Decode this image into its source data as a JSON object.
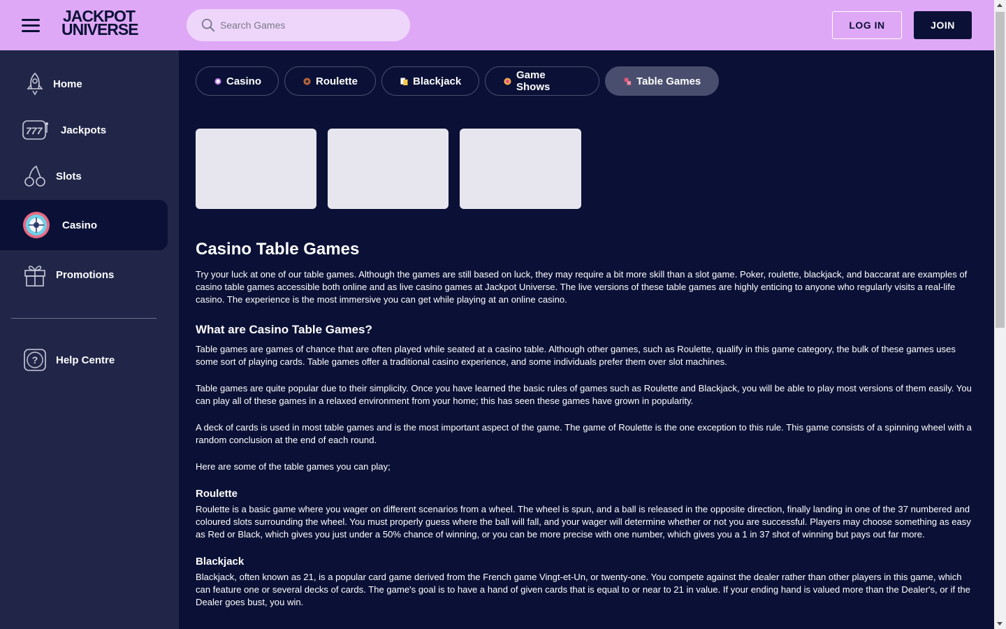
{
  "header": {
    "brand_line1": "JACKPOT",
    "brand_line2": "UNIVERSE",
    "search_placeholder": "Search Games",
    "login_label": "LOG IN",
    "join_label": "JOIN"
  },
  "sidebar": {
    "items": [
      {
        "label": "Home",
        "icon": "rocket-icon"
      },
      {
        "label": "Jackpots",
        "icon": "slot-machine-777-icon"
      },
      {
        "label": "Slots",
        "icon": "cherries-icon"
      },
      {
        "label": "Casino",
        "icon": "roulette-wheel-icon",
        "active": true
      },
      {
        "label": "Promotions",
        "icon": "gift-icon"
      }
    ],
    "help": {
      "label": "Help Centre",
      "icon": "help-question-icon"
    }
  },
  "tabs": [
    {
      "label": "Casino",
      "icon": "casino-chip-icon"
    },
    {
      "label": "Roulette",
      "icon": "roulette-icon"
    },
    {
      "label": "Blackjack",
      "icon": "cards-icon"
    },
    {
      "label": "Game Shows",
      "icon": "game-show-icon"
    },
    {
      "label": "Table Games",
      "icon": "dice-icon",
      "active": true
    }
  ],
  "colors": {
    "header_bg": "#dfa8f6",
    "main_bg": "#0b1136",
    "sidebar_bg": "#212649",
    "active_tab_bg": "#4a4e6e",
    "card_placeholder": "#e7e6ee"
  },
  "content": {
    "title": "Casino Table Games",
    "intro": "Try your luck at one of our table games. Although the games are still based on luck, they may require a bit more skill than a slot game. Poker, roulette, blackjack, and baccarat are examples of casino table games accessible both online and as live casino games at Jackpot Universe. The live versions of these table games are highly enticing to anyone who regularly visits a real-life casino. The experience is the most immersive you can get while playing at an online casino.",
    "h2": "What are Casino Table Games?",
    "p1": "Table games are games of chance that are often played while seated at a casino table. Although other games, such as Roulette, qualify in this game category, the bulk of these games uses some sort of playing cards. Table games offer a traditional casino experience, and some individuals prefer them over slot machines.",
    "p2": "Table games are quite popular due to their simplicity. Once you have learned the basic rules of games such as Roulette and Blackjack, you will be able to play most versions of them easily. You can play all of these games in a relaxed environment from your home; this has seen these games have grown in popularity.",
    "p3": "A deck of cards is used in most table games and is the most important aspect of the game. The game of Roulette is the one exception to this rule. This game consists of a spinning wheel with a random conclusion at the end of each round.",
    "p4": "Here are some of the table games you can play;",
    "roulette_title": "Roulette",
    "roulette_text": "Roulette is a basic game where you wager on different scenarios from a wheel. The wheel is spun, and a ball is released in the opposite direction, finally landing in one of the 37 numbered and coloured slots surrounding the wheel. You must properly guess where the ball will fall, and your wager will determine whether or not you are successful. Players may choose something as easy as Red or Black, which gives you just under a 50% chance of winning, or you can be more precise with one number, which gives you a 1 in 37 shot of winning but pays out far more.",
    "blackjack_title": "Blackjack",
    "blackjack_text": "Blackjack, often known as 21, is a popular card game derived from the French game Vingt-et-Un, or twenty-one. You compete against the dealer rather than other players in this game, which can feature one or several decks of cards. The game's goal is to have a hand of given cards that is equal to or near to 21 in value. If your ending hand is valued more than the Dealer's, or if the Dealer goes bust, you win."
  }
}
